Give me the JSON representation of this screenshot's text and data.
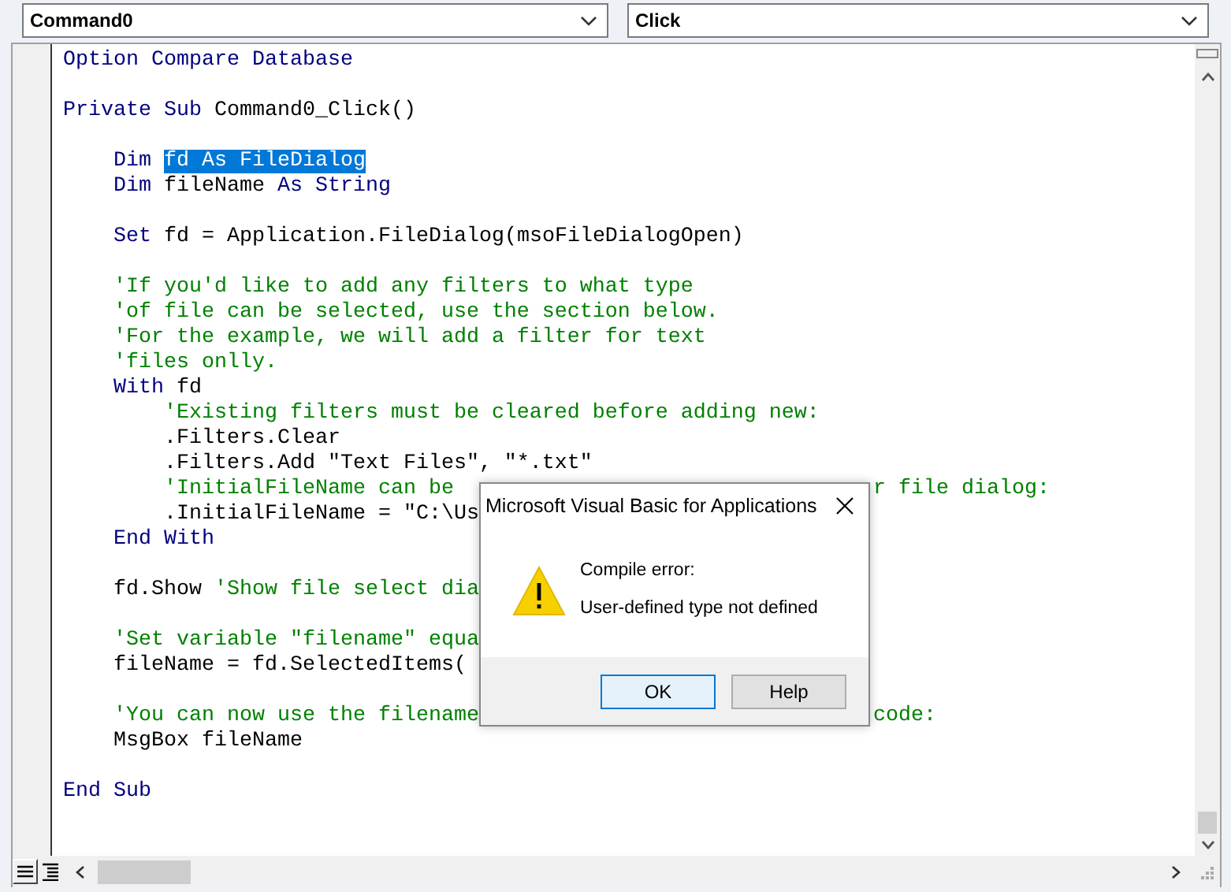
{
  "object_box": {
    "value": "Command0"
  },
  "procedure_box": {
    "value": "Click"
  },
  "code_lines": [
    {
      "kind": "code",
      "tokens": [
        {
          "kind": "keyword",
          "text": "Option Compare Database"
        }
      ]
    },
    {
      "kind": "blank"
    },
    {
      "kind": "code",
      "tokens": [
        {
          "kind": "keyword",
          "text": "Private Sub "
        },
        {
          "kind": "plain",
          "text": "Command0_Click()"
        }
      ]
    },
    {
      "kind": "blank"
    },
    {
      "kind": "code",
      "tokens": [
        {
          "kind": "keyword",
          "text": "    Dim "
        },
        {
          "kind": "selected",
          "text": "fd As FileDialog"
        }
      ]
    },
    {
      "kind": "code",
      "tokens": [
        {
          "kind": "keyword",
          "text": "    Dim "
        },
        {
          "kind": "plain",
          "text": "fileName "
        },
        {
          "kind": "keyword",
          "text": "As String"
        }
      ]
    },
    {
      "kind": "blank"
    },
    {
      "kind": "code",
      "tokens": [
        {
          "kind": "keyword",
          "text": "    Set "
        },
        {
          "kind": "plain",
          "text": "fd = Application.FileDialog(msoFileDialogOpen)"
        }
      ]
    },
    {
      "kind": "blank"
    },
    {
      "kind": "code",
      "tokens": [
        {
          "kind": "comment",
          "text": "    'If you'd like to add any filters to what type"
        }
      ]
    },
    {
      "kind": "code",
      "tokens": [
        {
          "kind": "comment",
          "text": "    'of file can be selected, use the section below."
        }
      ]
    },
    {
      "kind": "code",
      "tokens": [
        {
          "kind": "comment",
          "text": "    'For the example, we will add a filter for text"
        }
      ]
    },
    {
      "kind": "code",
      "tokens": [
        {
          "kind": "comment",
          "text": "    'files onlly."
        }
      ]
    },
    {
      "kind": "code",
      "tokens": [
        {
          "kind": "keyword",
          "text": "    With "
        },
        {
          "kind": "plain",
          "text": "fd"
        }
      ]
    },
    {
      "kind": "code",
      "tokens": [
        {
          "kind": "comment",
          "text": "        'Existing filters must be cleared before adding new:"
        }
      ]
    },
    {
      "kind": "code",
      "tokens": [
        {
          "kind": "plain",
          "text": "        .Filters.Clear"
        }
      ]
    },
    {
      "kind": "code",
      "tokens": [
        {
          "kind": "plain",
          "text": "        .Filters.Add \"Text Files\", \"*.txt\""
        }
      ]
    },
    {
      "kind": "code",
      "tokens": [
        {
          "kind": "comment",
          "text": "        'InitialFileName can be"
        }
      ],
      "right_tokens": [
        {
          "kind": "comment",
          "text": "r file dialog:"
        }
      ]
    },
    {
      "kind": "code",
      "tokens": [
        {
          "kind": "plain",
          "text": "        .InitialFileName = \"C:\\Us"
        }
      ]
    },
    {
      "kind": "code",
      "tokens": [
        {
          "kind": "keyword",
          "text": "    End With"
        }
      ]
    },
    {
      "kind": "blank"
    },
    {
      "kind": "code",
      "tokens": [
        {
          "kind": "plain",
          "text": "    fd.Show "
        },
        {
          "kind": "comment",
          "text": "'Show file select dia"
        }
      ]
    },
    {
      "kind": "blank"
    },
    {
      "kind": "code",
      "tokens": [
        {
          "kind": "comment",
          "text": "    'Set variable \"filename\" equa"
        }
      ]
    },
    {
      "kind": "code",
      "tokens": [
        {
          "kind": "plain",
          "text": "    fileName = fd.SelectedItems("
        }
      ]
    },
    {
      "kind": "blank"
    },
    {
      "kind": "code",
      "tokens": [
        {
          "kind": "comment",
          "text": "    'You can now use the filename"
        }
      ],
      "right_tokens": [
        {
          "kind": "comment",
          "text": "code:"
        }
      ]
    },
    {
      "kind": "code",
      "tokens": [
        {
          "kind": "plain",
          "text": "    MsgBox fileName"
        }
      ]
    },
    {
      "kind": "blank"
    },
    {
      "kind": "code",
      "tokens": [
        {
          "kind": "keyword",
          "text": "End Sub"
        }
      ]
    }
  ],
  "dialog": {
    "title": "Microsoft Visual Basic for Applications",
    "heading": "Compile error:",
    "message": "User-defined type not defined",
    "buttons": [
      {
        "label": "OK",
        "default": true
      },
      {
        "label": "Help",
        "default": false
      }
    ]
  }
}
